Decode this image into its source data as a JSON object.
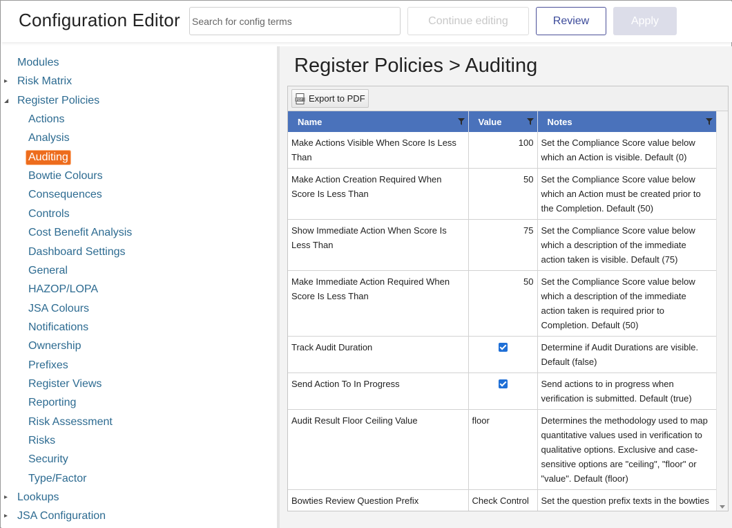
{
  "header": {
    "title": "Configuration Editor",
    "search_placeholder": "Search for config terms",
    "continue_label": "Continue editing",
    "review_label": "Review",
    "apply_label": "Apply"
  },
  "sidebar": {
    "items": [
      {
        "label": "Modules",
        "level": 0,
        "caret": ""
      },
      {
        "label": "Risk Matrix",
        "level": 0,
        "caret": "collapsed"
      },
      {
        "label": "Register Policies",
        "level": 0,
        "caret": "expanded"
      },
      {
        "label": "Actions",
        "level": 1
      },
      {
        "label": "Analysis",
        "level": 1
      },
      {
        "label": "Auditing",
        "level": 1,
        "active": true
      },
      {
        "label": "Bowtie Colours",
        "level": 1
      },
      {
        "label": "Consequences",
        "level": 1
      },
      {
        "label": "Controls",
        "level": 1
      },
      {
        "label": "Cost Benefit Analysis",
        "level": 1
      },
      {
        "label": "Dashboard Settings",
        "level": 1
      },
      {
        "label": "General",
        "level": 1
      },
      {
        "label": "HAZOP/LOPA",
        "level": 1
      },
      {
        "label": "JSA Colours",
        "level": 1
      },
      {
        "label": "Notifications",
        "level": 1
      },
      {
        "label": "Ownership",
        "level": 1
      },
      {
        "label": "Prefixes",
        "level": 1
      },
      {
        "label": "Register Views",
        "level": 1
      },
      {
        "label": "Reporting",
        "level": 1
      },
      {
        "label": "Risk Assessment",
        "level": 1
      },
      {
        "label": "Risks",
        "level": 1
      },
      {
        "label": "Security",
        "level": 1
      },
      {
        "label": "Type/Factor",
        "level": 1
      },
      {
        "label": "Lookups",
        "level": 0,
        "caret": "collapsed"
      },
      {
        "label": "JSA Configuration",
        "level": 0,
        "caret": "collapsed"
      }
    ]
  },
  "main": {
    "page_title": "Register Policies > Auditing",
    "export_label": "Export to PDF",
    "columns": [
      "Name",
      "Value",
      "Notes"
    ],
    "rows": [
      {
        "name": "Make Actions Visible When Score Is Less Than",
        "value": "100",
        "value_type": "number",
        "notes": "Set the Compliance Score value below which an Action is visible. Default (0)"
      },
      {
        "name": "Make Action Creation Required When Score Is Less Than",
        "value": "50",
        "value_type": "number",
        "notes": "Set the Compliance Score value below which an Action must be created prior to the Completion. Default (50)"
      },
      {
        "name": "Show Immediate Action When Score Is Less Than",
        "value": "75",
        "value_type": "number",
        "notes": "Set the Compliance Score value below which a description of the immediate action taken is visible. Default (75)"
      },
      {
        "name": "Make Immediate Action Required When Score Is Less Than",
        "value": "50",
        "value_type": "number",
        "notes": "Set the Compliance Score value below which a description of the immediate action taken is required prior to Completion. Default (50)"
      },
      {
        "name": "Track Audit Duration",
        "value": "",
        "value_type": "checkbox",
        "checked": true,
        "notes": "Determine if Audit Durations are visible. Default (false)"
      },
      {
        "name": "Send Action To In Progress",
        "value": "",
        "value_type": "checkbox",
        "checked": true,
        "notes": "Send actions to in progress when verification is submitted. Default (true)"
      },
      {
        "name": "Audit Result Floor Ceiling Value",
        "value": "floor",
        "value_type": "text",
        "notes": "Determines the methodology used to map quantitative values used in verification to qualitative options. Exclusive and case-sensitive options are \"ceiling\", \"floor\" or \"value\". Default (floor)"
      },
      {
        "name": "Bowties Review Question Prefix",
        "value": "Check Control Effective -",
        "value_type": "text",
        "notes": "Set the question prefix texts in the bowties review verification. Default (Check Control Effective -)"
      }
    ]
  },
  "colors": {
    "accent_active": "#ed6c1d",
    "header_blue": "#4a72bb",
    "link_blue": "#2d6b91",
    "review_border": "#4a4f98"
  }
}
